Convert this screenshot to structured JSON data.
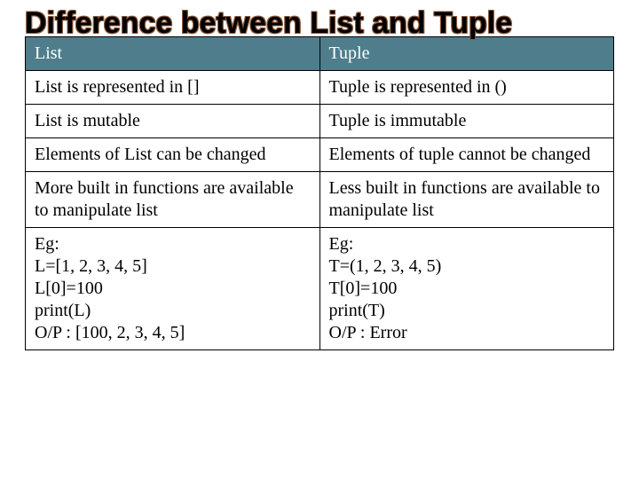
{
  "title": "Difference between List and Tuple",
  "table": {
    "header": {
      "left": "List",
      "right": "Tuple"
    },
    "rows": [
      {
        "left": "List is represented in []",
        "right": "Tuple is represented in ()"
      },
      {
        "left": "List is mutable",
        "right": "Tuple is immutable"
      },
      {
        "left": "Elements of List can be changed",
        "right": "Elements of tuple cannot be changed"
      },
      {
        "left": "More built in functions are available to manipulate list",
        "right": "Less built in functions are available to manipulate list"
      },
      {
        "left": "Eg:\nL=[1, 2, 3, 4, 5]\nL[0]=100\nprint(L)\nO/P : [100, 2, 3, 4, 5]",
        "right": "Eg:\nT=(1, 2, 3, 4, 5)\nT[0]=100\nprint(T)\nO/P : Error"
      }
    ]
  }
}
